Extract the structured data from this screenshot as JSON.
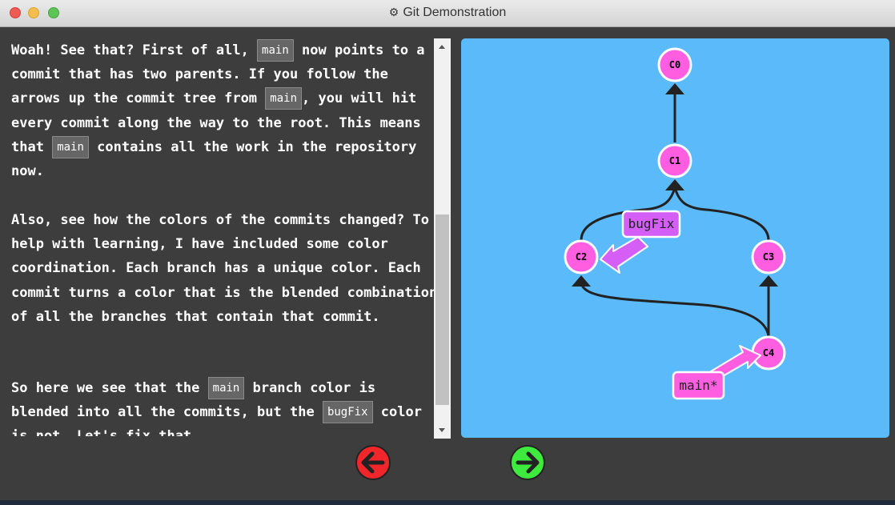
{
  "window": {
    "title": "Git Demonstration",
    "title_icon": "gear-icon"
  },
  "text": {
    "p1": {
      "s1": "Woah! See that? First of all, ",
      "c1": "main",
      "s2": " now points to a commit that has two parents. If you follow the arrows up the commit tree from ",
      "c2": "main",
      "s3": ", you will hit every commit along the way to the root. This means that ",
      "c3": "main",
      "s4": " contains all the work in the repository now."
    },
    "p2": "Also, see how the colors of the commits changed? To help with learning, I have included some color coordination. Each branch has a unique color. Each commit turns a color that is the blended combination of all the branches that contain that commit.",
    "p3": {
      "s1": "So here we see that the ",
      "c1": "main",
      "s2": " branch color is blended into all the commits, but the ",
      "c2": "bugFix",
      "s3": " color is not. Let's fix that..."
    }
  },
  "graph": {
    "background": "#5bbaf9",
    "commit_color": "#ff5ee1",
    "commits": [
      "C0",
      "C1",
      "C2",
      "C3",
      "C4"
    ],
    "branches": [
      {
        "name": "bugFix",
        "color": "#d45ef6",
        "target": "C2"
      },
      {
        "name": "main*",
        "color": "#ff5ee1",
        "target": "C4"
      }
    ]
  },
  "nav": {
    "back_icon": "arrow-left-icon",
    "back_color": "#f0262b",
    "forward_icon": "arrow-right-icon",
    "forward_color": "#3fea3f"
  }
}
